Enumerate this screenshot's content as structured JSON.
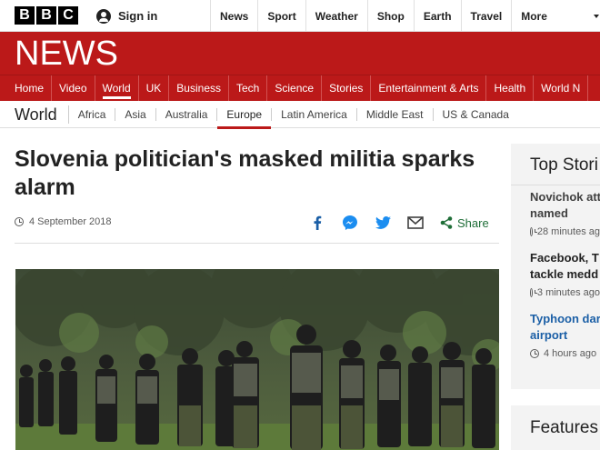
{
  "topbar": {
    "logo_letters": [
      "B",
      "B",
      "C"
    ],
    "signin_label": "Sign in",
    "nav": [
      "News",
      "Sport",
      "Weather",
      "Shop",
      "Earth",
      "Travel"
    ],
    "more_label": "More"
  },
  "banner": {
    "title": "NEWS",
    "color": "#bb1919"
  },
  "section_nav": {
    "items": [
      "Home",
      "Video",
      "World",
      "UK",
      "Business",
      "Tech",
      "Science",
      "Stories",
      "Entertainment & Arts",
      "Health",
      "World N"
    ],
    "active": "World"
  },
  "sub_nav": {
    "section": "World",
    "items": [
      "Africa",
      "Asia",
      "Australia",
      "Europe",
      "Latin America",
      "Middle East",
      "US & Canada"
    ],
    "active": "Europe"
  },
  "article": {
    "headline": "Slovenia politician's masked militia sparks alarm",
    "date": "4 September 2018",
    "share_label": "Share",
    "share_icons": [
      "facebook-icon",
      "messenger-icon",
      "twitter-icon",
      "email-icon"
    ]
  },
  "sidebar": {
    "heading": "Top Stori",
    "stories": [
      {
        "title_lines": [
          "Novichok att",
          "named"
        ],
        "time": "28 minutes ag",
        "link_color": "#404040"
      },
      {
        "title_lines": [
          "Facebook, T",
          "tackle medd"
        ],
        "time": "3 minutes ago",
        "link_color": "#222222"
      },
      {
        "title_lines": [
          "Typhoon dar",
          "airport"
        ],
        "time": "4 hours ago",
        "link_color": "#1b5fa6"
      }
    ],
    "features_heading": "Features"
  }
}
